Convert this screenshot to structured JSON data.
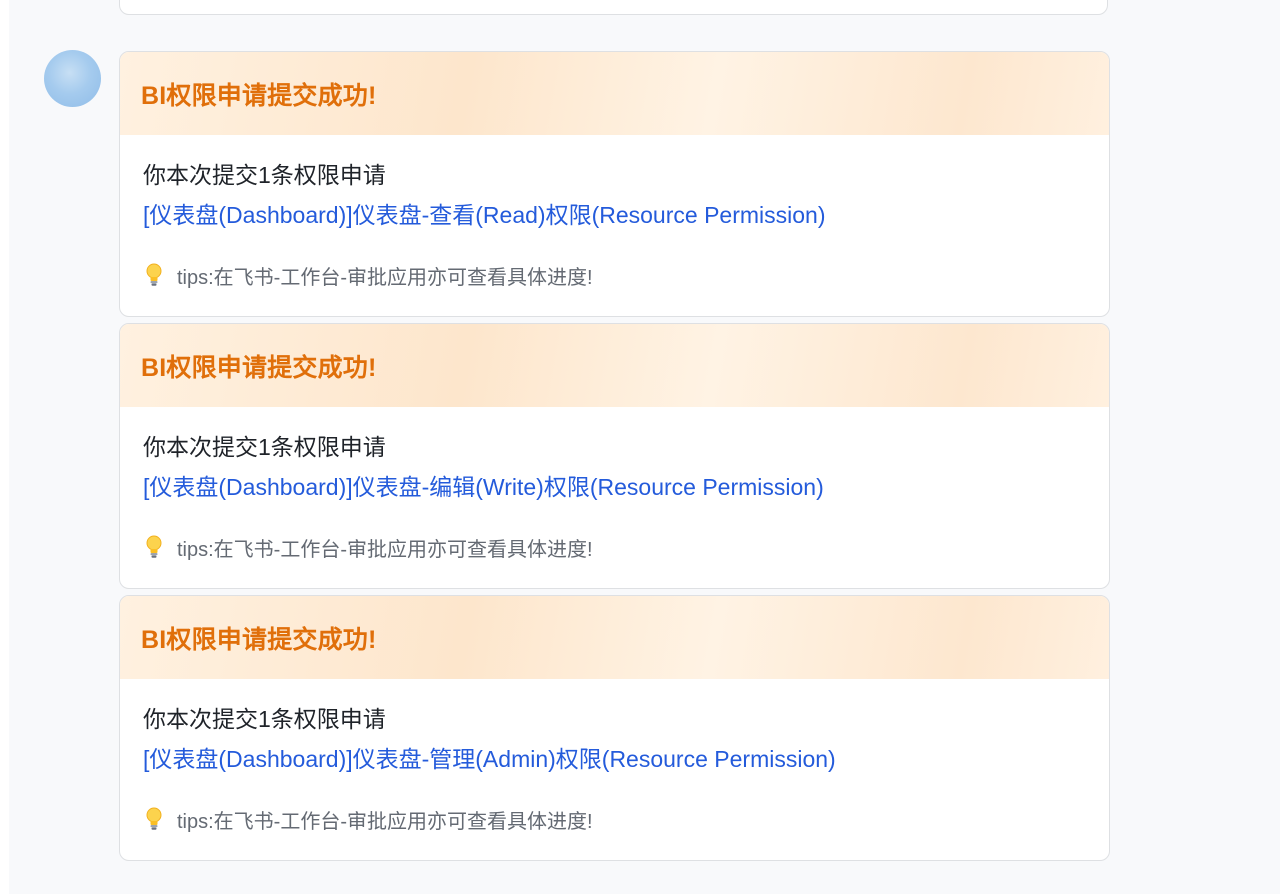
{
  "cards": [
    {
      "title": "BI权限申请提交成功!",
      "summary": "你本次提交1条权限申请",
      "permission_link": "[仪表盘(Dashboard)]仪表盘-查看(Read)权限(Resource Permission)",
      "tip": "tips:在飞书-工作台-审批应用亦可查看具体进度!",
      "tip_icon": "lightbulb-icon"
    },
    {
      "title": "BI权限申请提交成功!",
      "summary": "你本次提交1条权限申请",
      "permission_link": "[仪表盘(Dashboard)]仪表盘-编辑(Write)权限(Resource Permission)",
      "tip": "tips:在飞书-工作台-审批应用亦可查看具体进度!",
      "tip_icon": "lightbulb-icon"
    },
    {
      "title": "BI权限申请提交成功!",
      "summary": "你本次提交1条权限申请",
      "permission_link": "[仪表盘(Dashboard)]仪表盘-管理(Admin)权限(Resource Permission)",
      "tip": "tips:在飞书-工作台-审批应用亦可查看具体进度!",
      "tip_icon": "lightbulb-icon"
    }
  ],
  "colors": {
    "title": "#e06f0a",
    "link": "#245bdb",
    "body_text": "#1f2329",
    "tip_text": "#646a73",
    "header_bg": "#fde6cc",
    "chat_bg": "#f8f9fb"
  }
}
